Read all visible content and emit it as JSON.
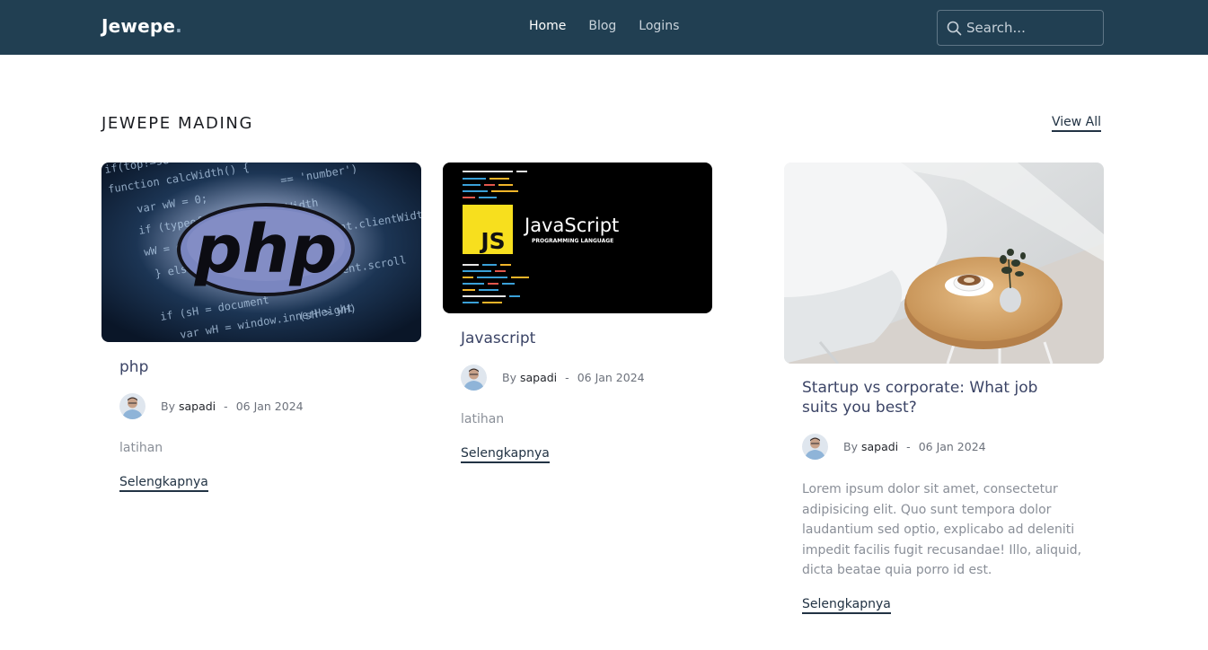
{
  "header": {
    "brand": "Jewepe",
    "brand_dot": ".",
    "nav": [
      "Home",
      "Blog",
      "Logins"
    ],
    "search_placeholder": "Search..."
  },
  "section": {
    "title": "JEWEPE MADING",
    "view_all": "View All"
  },
  "posts": [
    {
      "title": "php",
      "by": "By",
      "author": "sapadi",
      "sep": "-",
      "date": "06 Jan 2024",
      "excerpt": "latihan",
      "more": "Selengkapnya",
      "image_text": "php"
    },
    {
      "title": "Javascript",
      "by": "By",
      "author": "sapadi",
      "sep": "-",
      "date": "06 Jan 2024",
      "excerpt": "latihan",
      "more": "Selengkapnya",
      "image_text": "JavaScript",
      "image_badge": "JS",
      "image_sub": "PROGRAMMING LANGUAGE"
    },
    {
      "title": "Startup vs corporate: What job suits you best?",
      "by": "By",
      "author": "sapadi",
      "sep": "-",
      "date": "06 Jan 2024",
      "excerpt": "Lorem ipsum dolor sit amet, consectetur adipisicing elit. Quo sunt tempora dolor laudantium sed optio, explicabo ad deleniti impedit facilis fugit recusandae! Illo, aliquid, dicta beatae quia porro id est.",
      "more": "Selengkapnya"
    }
  ],
  "colors": {
    "navbar": "#213f52",
    "accent": "#223344"
  }
}
